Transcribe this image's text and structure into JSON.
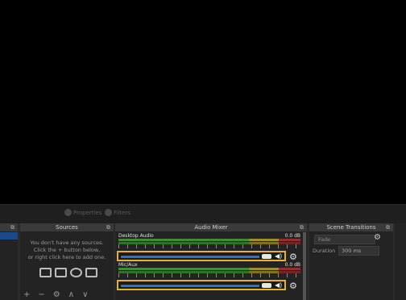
{
  "toolbar": {
    "properties_label": "Properties",
    "filters_label": "Filters"
  },
  "scenes": {
    "title": ""
  },
  "sources": {
    "title": "Sources",
    "empty_message": [
      "You don't have any sources.",
      "Click the + button below,",
      "or right click here to add one."
    ],
    "controls": [
      "+",
      "−",
      "⚙",
      "∧",
      "∨"
    ]
  },
  "audio_mixer": {
    "title": "Audio Mixer",
    "channels": [
      {
        "name": "Desktop Audio",
        "level": "0.0 dB"
      },
      {
        "name": "Mic/Aux",
        "level": "0.0 dB"
      }
    ]
  },
  "scene_transitions": {
    "title": "Scene Transitions",
    "transition_value": "Fade",
    "duration_label": "Duration",
    "duration_value": "300 ms"
  },
  "colors": {
    "highlight": "#e3b522",
    "fader": "#2f6fd0",
    "meter_green": "#4caf3c",
    "selection": "#1b4a8a"
  }
}
